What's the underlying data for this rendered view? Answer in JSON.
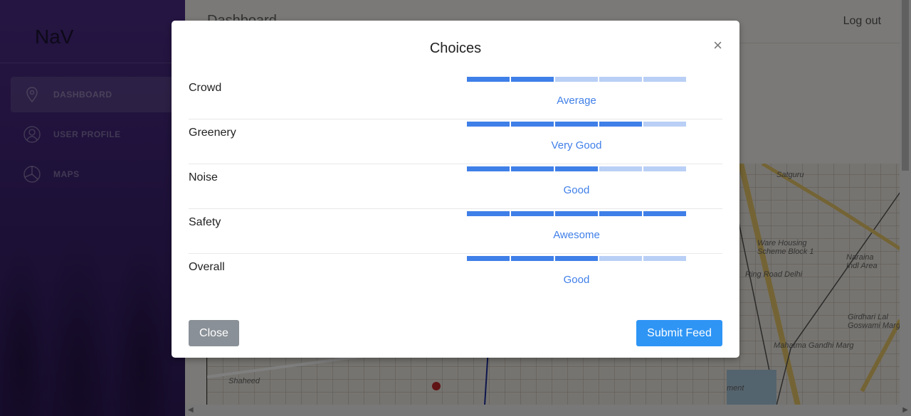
{
  "sidebar": {
    "brand": "NaV",
    "items": [
      {
        "label": "DASHBOARD",
        "icon": "map-pin-icon",
        "active": true
      },
      {
        "label": "USER PROFILE",
        "icon": "user-icon",
        "active": false
      },
      {
        "label": "MAPS",
        "icon": "pie-chart-icon",
        "active": false
      }
    ]
  },
  "header": {
    "title": "Dashboard",
    "logout_label": "Log out"
  },
  "map": {
    "labels": [
      "Satguru",
      "Ware Housing Scheme Block 1",
      "Naraina Indl Area",
      "Ring Road Delhi",
      "Mahatma Gandhi Marg",
      "Girdhari Lal Goswami Marg",
      "Shaheed",
      "ment"
    ]
  },
  "modal": {
    "title": "Choices",
    "close_icon_glyph": "×",
    "rows": [
      {
        "label": "Crowd",
        "rating": 2,
        "max": 5,
        "rating_text": "Average"
      },
      {
        "label": "Greenery",
        "rating": 4,
        "max": 5,
        "rating_text": "Very Good"
      },
      {
        "label": "Noise",
        "rating": 3,
        "max": 5,
        "rating_text": "Good"
      },
      {
        "label": "Safety",
        "rating": 5,
        "max": 5,
        "rating_text": "Awesome"
      },
      {
        "label": "Overall",
        "rating": 3,
        "max": 5,
        "rating_text": "Good"
      }
    ],
    "close_label": "Close",
    "submit_label": "Submit Feed"
  },
  "colors": {
    "accent": "#3f7fe8",
    "accent_light": "#b9cff5",
    "submit": "#2e95f5",
    "close_button": "#8a9097"
  }
}
